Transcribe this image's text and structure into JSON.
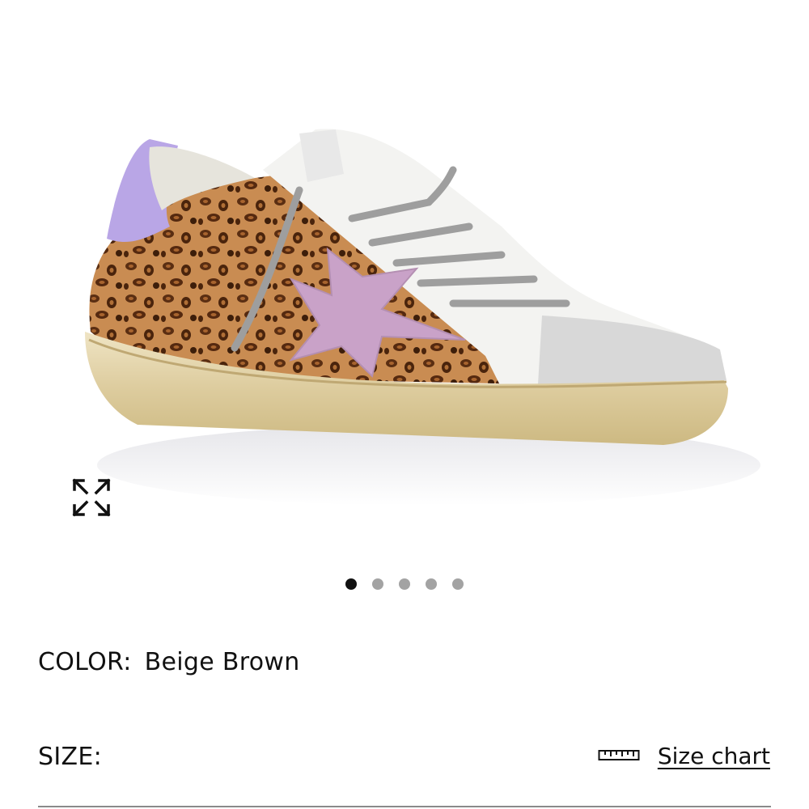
{
  "product": {
    "image_alt": "Leopard print low-top sneaker with pink star and lavender heel tab",
    "carousel": {
      "count": 5,
      "active_index": 0
    }
  },
  "color": {
    "label": "COLOR:",
    "value": "Beige Brown"
  },
  "size": {
    "label": "SIZE:"
  },
  "size_chart": {
    "label": "Size chart",
    "icon": "ruler-icon"
  },
  "icons": {
    "expand": "expand-icon"
  },
  "colors": {
    "text": "#111111",
    "dot_active": "#111111",
    "dot_inactive": "#a3a3a3",
    "divider": "#8a8a8a"
  }
}
